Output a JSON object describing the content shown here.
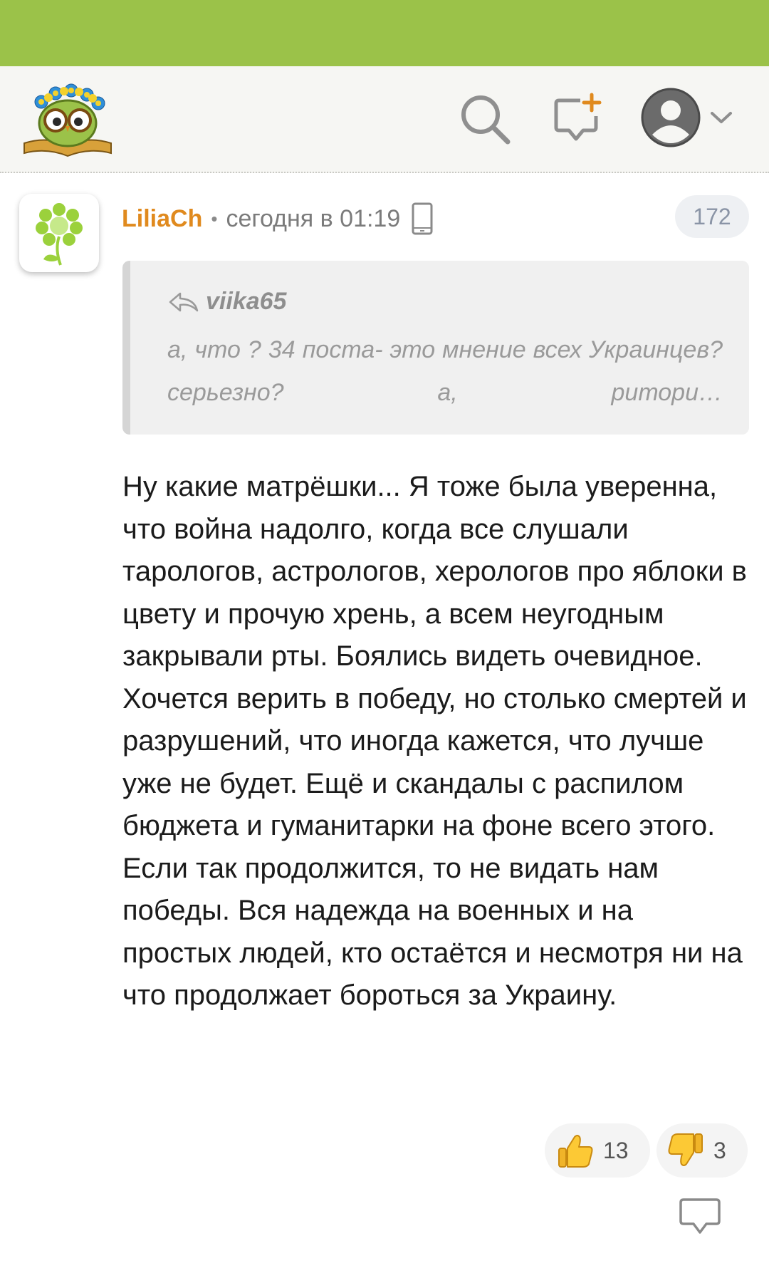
{
  "colors": {
    "brand_green": "#9bc249",
    "author_orange": "#e08a1e",
    "badge_text": "#8a94a6"
  },
  "header": {
    "icons": [
      "logo-owl-icon",
      "search-icon",
      "new-post-icon",
      "user-avatar-icon",
      "chevron-down-icon"
    ]
  },
  "comment": {
    "author": "LiliaCh",
    "separator": "•",
    "time": "сегодня в 01:19",
    "device_icon": "phone-icon",
    "number": "172",
    "quote": {
      "author": "viika65",
      "text": "а, что ? 34 поста- это мнение всех Украинцев? серьезно? а, ритори…"
    },
    "text": "Ну какие матрёшки... Я тоже была уверенна, что война надолго, когда все слушали тарологов, астрологов, херологов про яблоки в цвету и прочую хрень, а всем неугодным закрывали рты. Боялись видеть очевидное. Хочется верить в победу, но столько смертей и разрушений, что иногда кажется, что лучше уже не будет. Ещё и скандалы с распилом бюджета и гуманитарки на фоне всего этого. Если так продолжится, то не видать нам победы. Вся надежда на военных и на простых людей, кто остаётся и несмотря ни на что продолжает бороться за Украину.",
    "likes": "13",
    "dislikes": "3"
  }
}
